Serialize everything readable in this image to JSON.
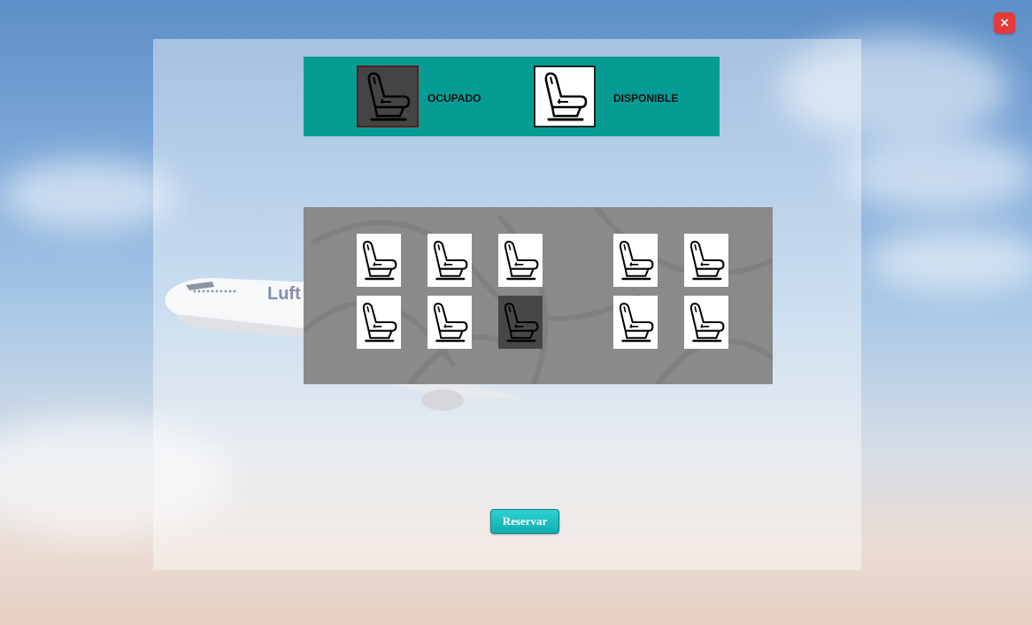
{
  "window": {
    "close_label": "×",
    "close_color": "#e43a3a"
  },
  "legend": {
    "occupied_label": "OCUPADO",
    "available_label": "DISPONIBLE",
    "background": "#069c94",
    "occupied_icon": "seat-icon",
    "available_icon": "seat-icon"
  },
  "seats": [
    {
      "row": 1,
      "col": 1,
      "status": "available"
    },
    {
      "row": 1,
      "col": 2,
      "status": "available"
    },
    {
      "row": 1,
      "col": 3,
      "status": "available"
    },
    {
      "row": 1,
      "col": 4,
      "status": "available"
    },
    {
      "row": 1,
      "col": 5,
      "status": "available"
    },
    {
      "row": 2,
      "col": 1,
      "status": "available"
    },
    {
      "row": 2,
      "col": 2,
      "status": "available"
    },
    {
      "row": 2,
      "col": 3,
      "status": "occupied"
    },
    {
      "row": 2,
      "col": 4,
      "status": "available"
    },
    {
      "row": 2,
      "col": 5,
      "status": "available"
    }
  ],
  "actions": {
    "reserve_label": "Reservar"
  },
  "background": {
    "plane_logo_text": "Luft"
  }
}
